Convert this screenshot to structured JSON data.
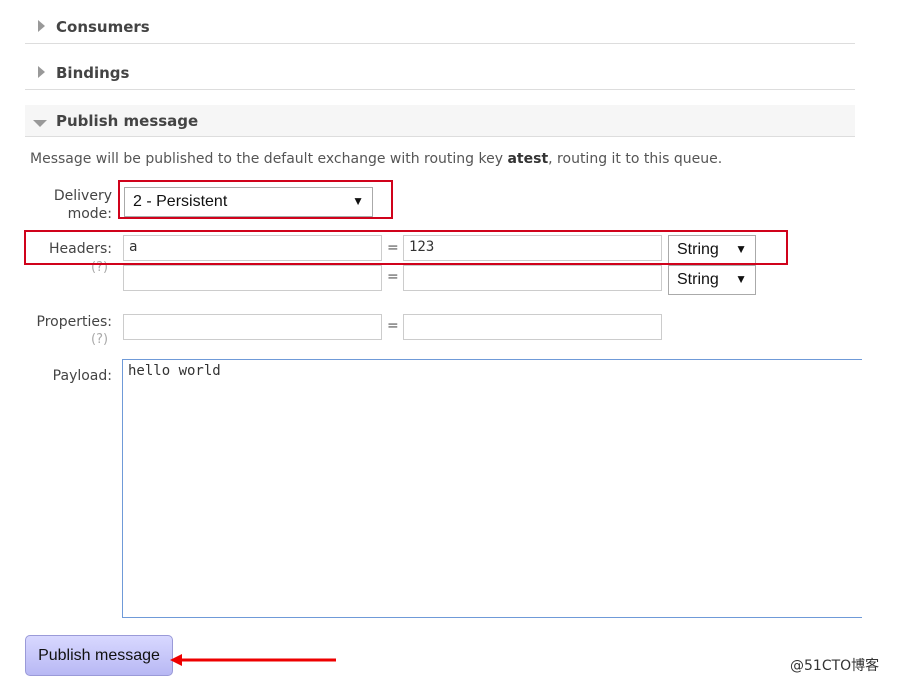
{
  "sections": {
    "consumers": "Consumers",
    "bindings": "Bindings",
    "publish": "Publish message"
  },
  "publish": {
    "intro_prefix": "Message will be published to the default exchange with routing key ",
    "routing_key": "atest",
    "intro_suffix": ", routing it to this queue.",
    "delivery_label_1": "Delivery",
    "delivery_label_2": "mode:",
    "delivery_value": "2 - Persistent",
    "headers_label": "Headers:",
    "help": "(?)",
    "headers": [
      {
        "key": "a",
        "value": "123",
        "type": "String"
      },
      {
        "key": "",
        "value": "",
        "type": "String"
      }
    ],
    "equals": "=",
    "properties_label": "Properties:",
    "payload_label": "Payload:",
    "payload": "hello world",
    "button": "Publish message",
    "arrow_char": "▼"
  },
  "watermark": "@51CTO博客",
  "colors": {
    "annotation_red": "#d0021b",
    "button_bg": "#c8c8fa",
    "payload_border": "#6f9ad8"
  }
}
